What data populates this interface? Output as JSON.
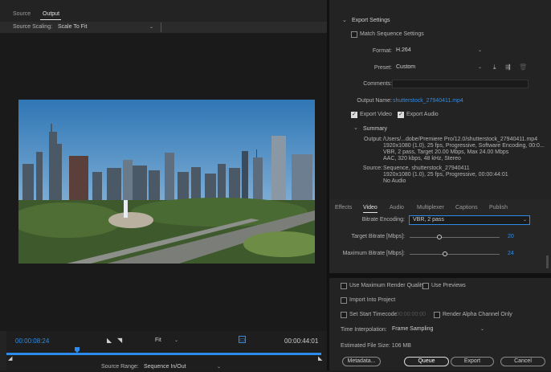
{
  "left_panel": {
    "tabs": [
      "Source",
      "Output"
    ],
    "source_scaling_label": "Source Scaling:",
    "source_scaling_value": "Scale To Fit",
    "timecode_current": "00:00:08:24",
    "timecode_end": "00:00:44:01",
    "fit_label": "Fit",
    "source_range_label": "Source Range:",
    "source_range_value": "Sequence In/Out",
    "playhead_progress": 0.19
  },
  "export_settings": {
    "header": "Export Settings",
    "match_sequence_label": "Match Sequence Settings",
    "format_label": "Format:",
    "format_value": "H.264",
    "preset_label": "Preset:",
    "preset_value": "Custom",
    "comments_label": "Comments:",
    "output_name_label": "Output Name:",
    "output_name_value": "shutterstock_27940411.mp4",
    "export_video_label": "Export Video",
    "export_audio_label": "Export Audio",
    "summary_header": "Summary",
    "output_label": "Output:",
    "output_lines": [
      "/Users/...dobe/Premiere Pro/12.0/shutterstock_27940411.mp4",
      "1920x1080 (1.0), 25 fps, Progressive, Software Encoding, 00:0...",
      "VBR, 2 pass, Target 20.00 Mbps, Max 24.00 Mbps",
      "AAC, 320 kbps, 48 kHz, Stereo"
    ],
    "source_label": "Source:",
    "source_lines": [
      "Sequence, shutterstock_27940411",
      "1920x1080 (1.0), 25 fps, Progressive, 00:00:44:01",
      "No Audio"
    ]
  },
  "video_tabs": [
    "Effects",
    "Video",
    "Audio",
    "Multiplexer",
    "Captions",
    "Publish"
  ],
  "video_settings": {
    "bitrate_encoding_label": "Bitrate Encoding:",
    "bitrate_encoding_value": "VBR, 2 pass",
    "target_bitrate_label": "Target Bitrate [Mbps]:",
    "target_bitrate_value": "20",
    "max_bitrate_label": "Maximum Bitrate [Mbps]:",
    "max_bitrate_value": "24"
  },
  "bottom": {
    "use_max_render_quality": "Use Maximum Render Quality",
    "use_previews": "Use Previews",
    "import_into_project": "Import Into Project",
    "set_start_timecode": "Set Start Timecode",
    "start_timecode_value": "00:00:00:00",
    "render_alpha": "Render Alpha Channel Only",
    "time_interpolation_label": "Time Interpolation:",
    "time_interpolation_value": "Frame Sampling",
    "estimated_file_size": "Estimated File Size:  106 MB",
    "buttons": {
      "metadata": "Metadata...",
      "queue": "Queue",
      "export": "Export",
      "cancel": "Cancel"
    }
  },
  "colors": {
    "accent": "#2d8ceb",
    "panel": "#232323",
    "video_bg": "#1a1a1a"
  }
}
